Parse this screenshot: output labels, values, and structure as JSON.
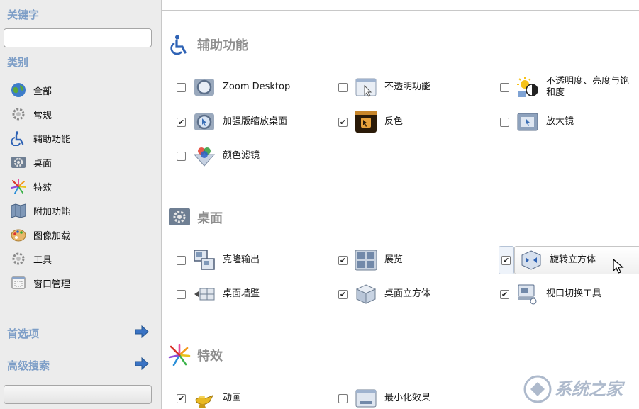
{
  "sidebar": {
    "search_heading": "关键字",
    "search_value": "",
    "category_heading": "类别",
    "categories": [
      {
        "label": "全部",
        "icon": "globe-icon"
      },
      {
        "label": "常规",
        "icon": "gear-icon"
      },
      {
        "label": "辅助功能",
        "icon": "accessibility-icon"
      },
      {
        "label": "桌面",
        "icon": "desktop-gear-icon"
      },
      {
        "label": "特效",
        "icon": "sparkle-icon"
      },
      {
        "label": "附加功能",
        "icon": "map-icon"
      },
      {
        "label": "图像加载",
        "icon": "palette-icon"
      },
      {
        "label": "工具",
        "icon": "gear-icon"
      },
      {
        "label": "窗口管理",
        "icon": "window-icon"
      }
    ],
    "preferences_label": "首选项",
    "advanced_search_label": "高级搜索"
  },
  "sections": {
    "accessibility": {
      "title": "辅助功能",
      "plugins": [
        {
          "label": "Zoom Desktop",
          "checked": false,
          "icon": "magnifier-icon"
        },
        {
          "label": "不透明功能",
          "checked": false,
          "icon": "window-opacity-icon"
        },
        {
          "label": "不透明度、亮度与饱和度",
          "checked": false,
          "icon": "brightness-icon"
        },
        {
          "label": "加强版缩放桌面",
          "checked": true,
          "icon": "magnifier-icon"
        },
        {
          "label": "反色",
          "checked": true,
          "icon": "invert-icon"
        },
        {
          "label": "放大镜",
          "checked": false,
          "icon": "zoom-window-icon"
        },
        {
          "label": "颜色滤镜",
          "checked": false,
          "icon": "color-filter-icon"
        }
      ]
    },
    "desktop": {
      "title": "桌面",
      "plugins": [
        {
          "label": "克隆输出",
          "checked": false,
          "icon": "clone-icon"
        },
        {
          "label": "展览",
          "checked": true,
          "icon": "expo-icon"
        },
        {
          "label": "旋转立方体",
          "checked": true,
          "icon": "rotate-cube-icon"
        },
        {
          "label": "桌面墙壁",
          "checked": false,
          "icon": "wall-icon"
        },
        {
          "label": "桌面立方体",
          "checked": true,
          "icon": "cube-icon"
        },
        {
          "label": "视口切换工具",
          "checked": true,
          "icon": "viewport-icon"
        }
      ]
    },
    "effects": {
      "title": "特效",
      "plugins": [
        {
          "label": "动画",
          "checked": true,
          "icon": "lamp-icon"
        },
        {
          "label": "最小化效果",
          "checked": false,
          "icon": "minimize-icon"
        }
      ]
    }
  },
  "watermark": {
    "text": "系统之家"
  },
  "colors": {
    "heading_blue": "#7d9ec7",
    "section_title_grey": "#8e8e8e",
    "arrow_blue": "#3a73c4"
  }
}
